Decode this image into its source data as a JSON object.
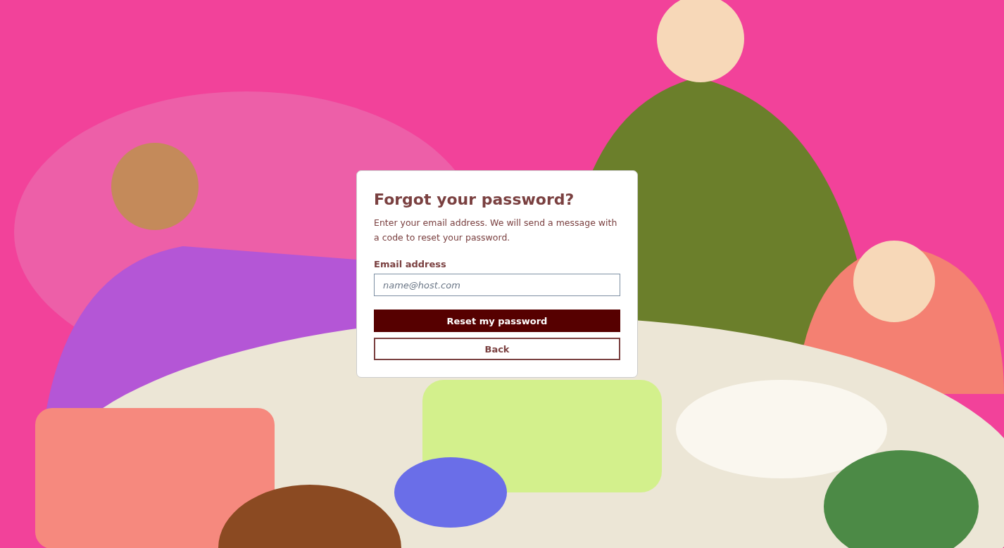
{
  "card": {
    "title": "Forgot your password?",
    "description": "Enter your email address. We will send a message with a code to reset your password.",
    "field": {
      "label": "Email address",
      "placeholder": "name@host.com"
    },
    "buttons": [
      {
        "label": "Reset my password",
        "kind": "primary"
      },
      {
        "label": "Back",
        "kind": "secondary"
      }
    ]
  }
}
